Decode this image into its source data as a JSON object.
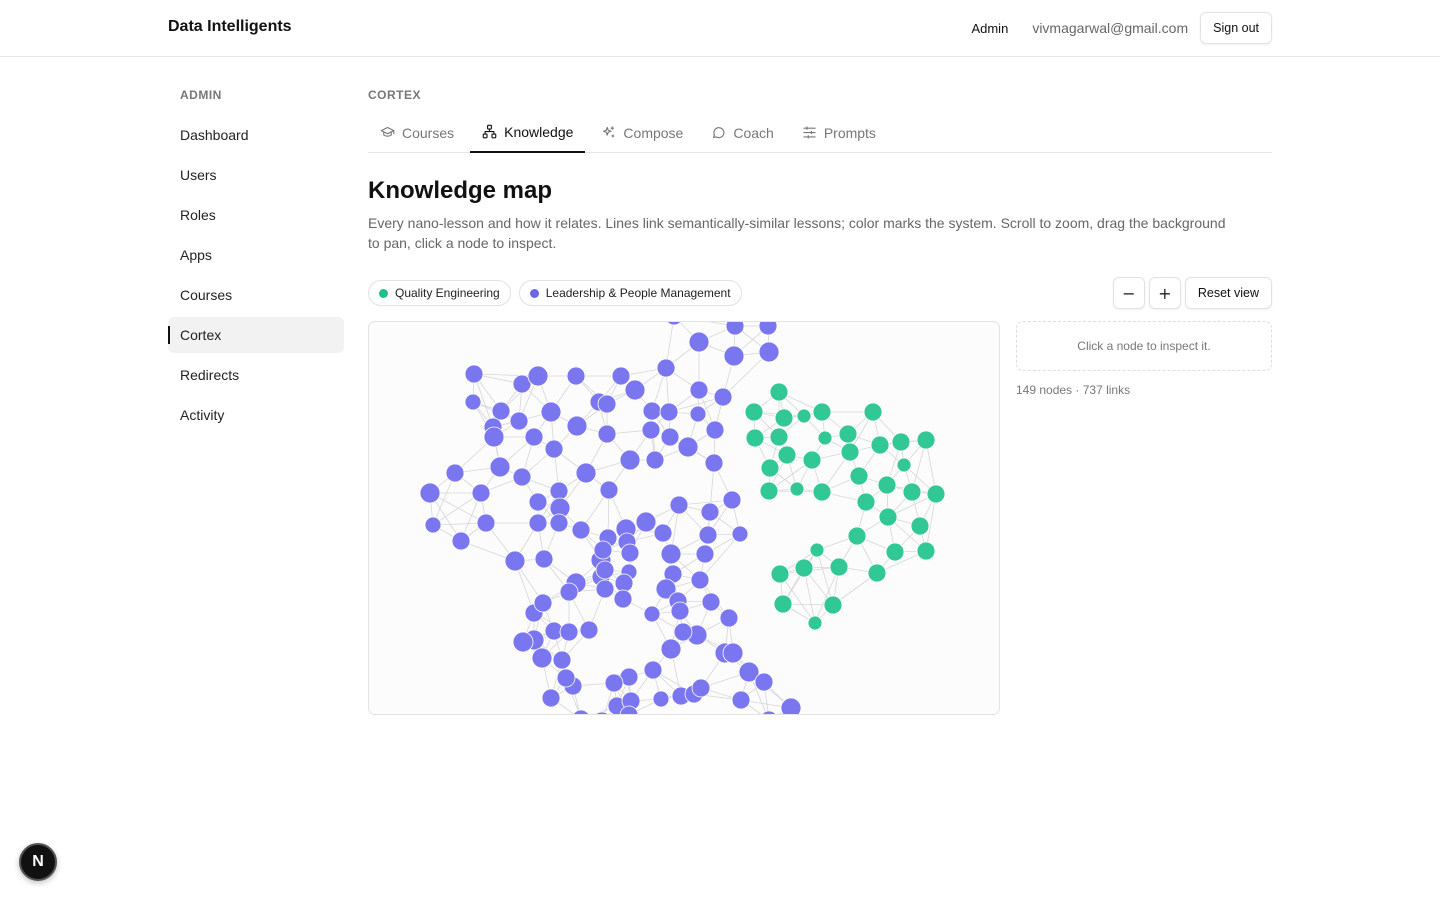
{
  "header": {
    "brand": "Data Intelligents",
    "role": "Admin",
    "email": "vivmagarwal@gmail.com",
    "signout_label": "Sign out"
  },
  "sidebar": {
    "heading": "ADMIN",
    "items": [
      {
        "label": "Dashboard",
        "active": false
      },
      {
        "label": "Users",
        "active": false
      },
      {
        "label": "Roles",
        "active": false
      },
      {
        "label": "Apps",
        "active": false
      },
      {
        "label": "Courses",
        "active": false
      },
      {
        "label": "Cortex",
        "active": true
      },
      {
        "label": "Redirects",
        "active": false
      },
      {
        "label": "Activity",
        "active": false
      }
    ]
  },
  "main": {
    "eyebrow": "CORTEX",
    "tabs": [
      {
        "label": "Courses",
        "icon": "graduation-cap-icon",
        "active": false
      },
      {
        "label": "Knowledge",
        "icon": "network-icon",
        "active": true
      },
      {
        "label": "Compose",
        "icon": "sparkles-icon",
        "active": false
      },
      {
        "label": "Coach",
        "icon": "chat-bubble-icon",
        "active": false
      },
      {
        "label": "Prompts",
        "icon": "sliders-icon",
        "active": false
      }
    ],
    "title": "Knowledge map",
    "description": "Every nano-lesson and how it relates. Lines link semantically-similar lessons; color marks the system. Scroll to zoom, drag the background to pan, click a node to inspect.",
    "legend": [
      {
        "label": "Quality Engineering",
        "color": "#20c08a"
      },
      {
        "label": "Leadership & People Management",
        "color": "#6b66e6"
      }
    ],
    "controls": {
      "zoom_out": "−",
      "zoom_in": "+",
      "reset_label": "Reset view"
    },
    "inspector_placeholder": "Click a node to inspect it.",
    "stats": "149 nodes · 737 links"
  },
  "graph": {
    "node_colors": {
      "quality": "#32c896",
      "leadership": "#7a76f0"
    },
    "edge_color": "#d6d6d6"
  },
  "dev_badge": "N"
}
